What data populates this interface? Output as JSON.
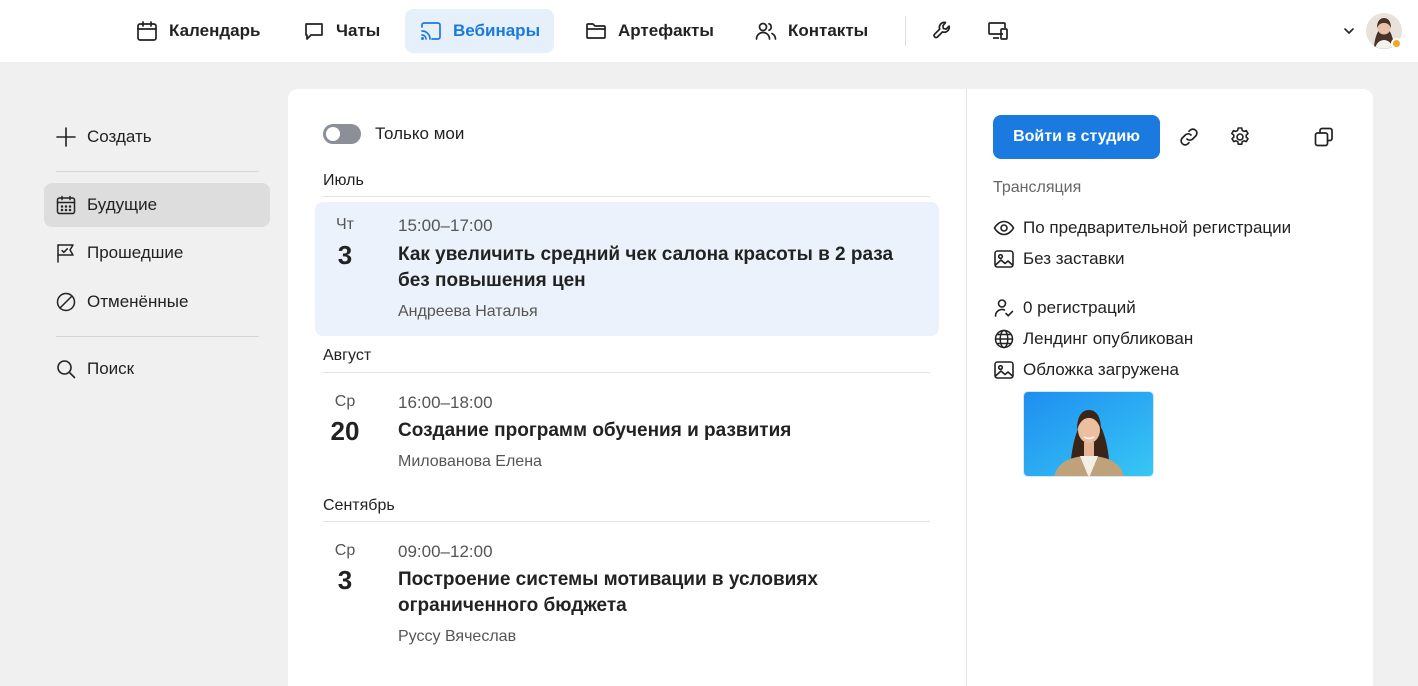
{
  "topnav": {
    "items": [
      {
        "label": "Календарь",
        "icon": "calendar-icon",
        "active": false
      },
      {
        "label": "Чаты",
        "icon": "chat-icon",
        "active": false
      },
      {
        "label": "Вебинары",
        "icon": "cast-icon",
        "active": true
      },
      {
        "label": "Артефакты",
        "icon": "folder-icon",
        "active": false
      },
      {
        "label": "Контакты",
        "icon": "contacts-icon",
        "active": false
      }
    ],
    "tools": [
      "wrench-icon",
      "devices-icon"
    ],
    "accent_color": "#1a7ae0",
    "status_color": "#f5a623"
  },
  "sidebar": {
    "create": "Создать",
    "items": [
      {
        "label": "Будущие",
        "icon": "calendar-grid-icon",
        "active": true
      },
      {
        "label": "Прошедшие",
        "icon": "flag-icon",
        "active": false
      },
      {
        "label": "Отменённые",
        "icon": "cancel-icon",
        "active": false
      }
    ],
    "search": "Поиск"
  },
  "list": {
    "toggle_label": "Только мои",
    "toggle_on": false,
    "groups": [
      {
        "month": "Июль",
        "events": [
          {
            "dow": "Чт",
            "day": "3",
            "time": "15:00–17:00",
            "title": "Как увеличить средний чек салона красоты в 2 раза без повышения цен",
            "host": "Андреева Наталья",
            "selected": true
          }
        ]
      },
      {
        "month": "Август",
        "events": [
          {
            "dow": "Ср",
            "day": "20",
            "time": "16:00–18:00",
            "title": "Создание программ обучения и развития",
            "host": "Милованова Елена",
            "selected": false
          }
        ]
      },
      {
        "month": "Сентябрь",
        "events": [
          {
            "dow": "Ср",
            "day": "3",
            "time": "09:00–12:00",
            "title": "Построение системы мотивации в условиях ограниченного бюджета",
            "host": "Руссу Вячеслав",
            "selected": false
          }
        ]
      }
    ]
  },
  "details": {
    "studio_button": "Войти в студию",
    "section_label": "Трансляция",
    "rows": [
      {
        "icon": "eye-icon",
        "text": "По предварительной регистрации"
      },
      {
        "icon": "image-icon",
        "text": "Без заставки"
      },
      {
        "icon": "user-check-icon",
        "text": "0 регистраций"
      },
      {
        "icon": "globe-icon",
        "text": "Лендинг опубликован"
      },
      {
        "icon": "image-icon",
        "text": "Обложка загружена"
      }
    ]
  }
}
